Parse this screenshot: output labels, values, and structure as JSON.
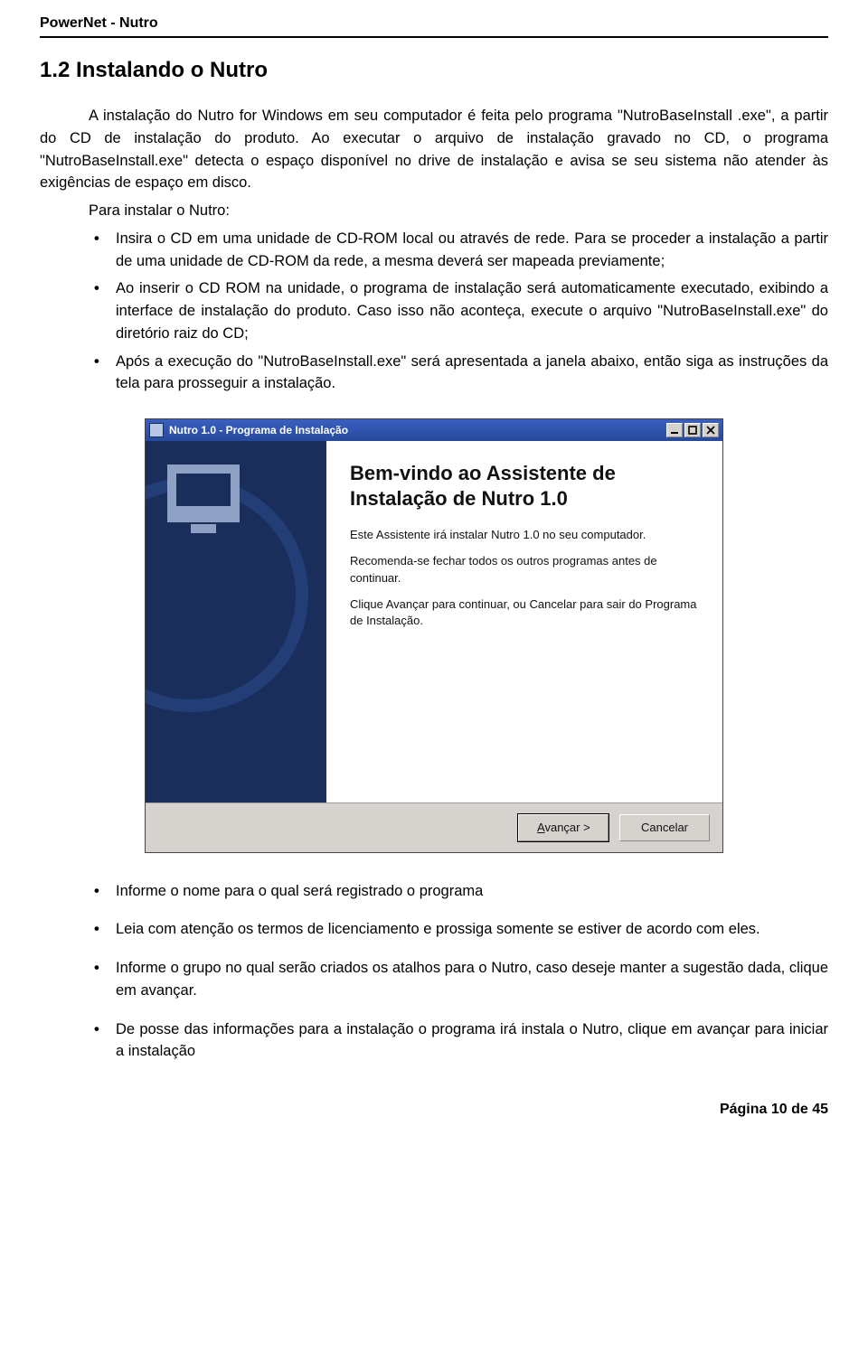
{
  "header": "PowerNet  -  Nutro",
  "section_title": "1.2 Instalando o Nutro",
  "para1": "A instalação do Nutro for Windows em seu computador é feita pelo programa \"NutroBaseInstall .exe\", a partir do CD de instalação do produto. Ao executar o arquivo de instalação gravado no CD, o programa \"NutroBaseInstall.exe\" detecta o espaço disponível no drive de instalação e avisa se seu sistema não atender às exigências de espaço em disco.",
  "para_lead": "Para instalar o Nutro:",
  "steps": [
    "Insira o CD em uma unidade de CD-ROM local ou através de rede. Para se proceder a instalação a partir de uma unidade de CD-ROM da rede, a mesma deverá ser mapeada previamente;",
    "Ao inserir o CD ROM na unidade, o programa de instalação será automaticamente executado, exibindo a interface de instalação do produto. Caso isso não aconteça, execute o arquivo \"NutroBaseInstall.exe\" do diretório raiz do CD;",
    "Após a execução do \"NutroBaseInstall.exe\" será apresentada a janela abaixo, então siga as instruções da tela para prosseguir a instalação."
  ],
  "installer": {
    "title": "Nutro 1.0 - Programa de Instalação",
    "heading": "Bem-vindo ao Assistente de Instalação de Nutro 1.0",
    "p1": "Este Assistente irá instalar Nutro 1.0 no seu computador.",
    "p2": "Recomenda-se fechar todos os outros programas antes de continuar.",
    "p3": "Clique Avançar para continuar, ou Cancelar para sair do Programa de Instalação.",
    "btn_next_accel": "A",
    "btn_next_rest": "vançar >",
    "btn_cancel": "Cancelar"
  },
  "post_steps": [
    "Informe o nome para o qual será registrado o programa",
    "Leia com atenção os termos de licenciamento e prossiga somente se estiver de acordo com eles.",
    "Informe o grupo no qual serão criados os atalhos para o Nutro, caso deseje manter a sugestão dada, clique em avançar.",
    "De posse das informações para a instalação o programa irá instala o Nutro, clique em avançar para iniciar a instalação"
  ],
  "footer": "Página 10 de 45"
}
